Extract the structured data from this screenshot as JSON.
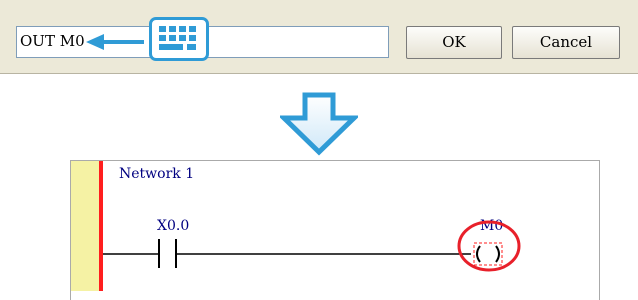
{
  "dialog": {
    "instruction_text": "OUT M0",
    "ok_label": "OK",
    "cancel_label": "Cancel"
  },
  "icons": {
    "input_arrow": "left-arrow-icon",
    "keyboard": "keyboard-icon",
    "flow": "down-arrow-icon"
  },
  "ladder": {
    "network_label": "Network 1",
    "contact_label": "X0.0",
    "coil_label": "M0"
  },
  "colors": {
    "accent_blue": "#2f9bd6",
    "highlight_red": "#e8202a",
    "rail_red": "#ff1e1e",
    "rail_yellow": "#f5f2a4"
  }
}
